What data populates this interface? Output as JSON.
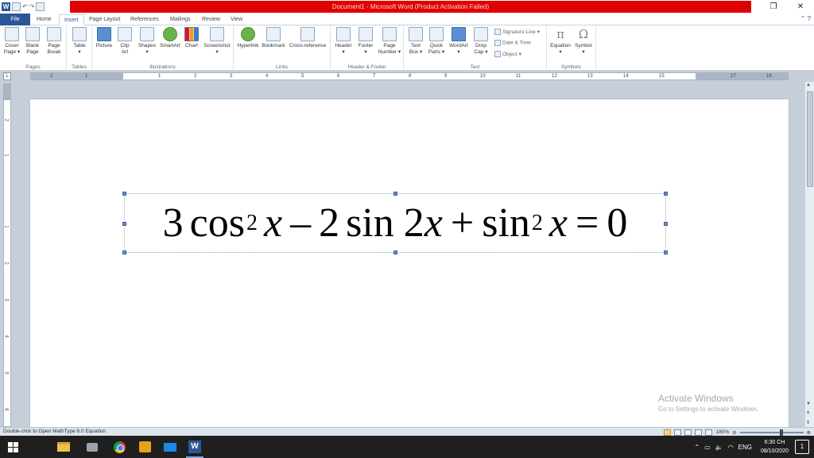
{
  "window": {
    "title": "Document1 - Microsoft Word (Product Activation Failed)",
    "controls": {
      "minimize": "–",
      "restore": "❐",
      "close": "✕"
    }
  },
  "tabs": [
    {
      "label": "File"
    },
    {
      "label": "Home"
    },
    {
      "label": "Insert"
    },
    {
      "label": "Page Layout"
    },
    {
      "label": "References"
    },
    {
      "label": "Mailings"
    },
    {
      "label": "Review"
    },
    {
      "label": "View"
    }
  ],
  "ribbon": {
    "pages": {
      "label": "Pages",
      "cover": "Cover\nPage ▾",
      "blank": "Blank\nPage",
      "break": "Page\nBreak"
    },
    "tables": {
      "label": "Tables",
      "table": "Table\n▾"
    },
    "illustrations": {
      "label": "Illustrations",
      "picture": "Picture",
      "clipart": "Clip\nArt",
      "shapes": "Shapes\n▾",
      "smartart": "SmartArt",
      "chart": "Chart",
      "screenshot": "Screenshot\n▾"
    },
    "links": {
      "label": "Links",
      "hyperlink": "Hyperlink",
      "bookmark": "Bookmark",
      "crossref": "Cross-reference"
    },
    "headerfooter": {
      "label": "Header & Footer",
      "header": "Header\n▾",
      "footer": "Footer\n▾",
      "pagenumber": "Page\nNumber ▾"
    },
    "text": {
      "label": "Text",
      "textbox": "Text\nBox ▾",
      "quickparts": "Quick\nParts ▾",
      "wordart": "WordArt\n▾",
      "dropcap": "Drop\nCap ▾",
      "signature": "Signature Line ▾",
      "datetime": "Date & Time",
      "object": "Object ▾"
    },
    "symbols": {
      "label": "Symbols",
      "equation": "Equation\n▾",
      "symbol": "Symbol\n▾"
    }
  },
  "ruler": {
    "corner": "L",
    "ticks": [
      "2",
      "1",
      "1",
      "2",
      "3",
      "4",
      "5",
      "6",
      "7",
      "8",
      "9",
      "10",
      "11",
      "12",
      "13",
      "14",
      "15",
      "17",
      "18"
    ],
    "vticks": [
      "2",
      "1",
      "1",
      "2",
      "3",
      "4",
      "5",
      "6"
    ]
  },
  "document": {
    "equation": {
      "coef1": "3",
      "fn1": "cos",
      "exp1": "2",
      "var1": "x",
      "op1": "–",
      "coef2": "2",
      "fn2": "sin",
      "arg2": "2",
      "var2": "x",
      "op2": "+",
      "fn3": "sin",
      "exp3": "2",
      "var3": "x",
      "eq": "=",
      "rhs": "0"
    }
  },
  "watermark": {
    "line1": "Activate Windows",
    "line2": "Go to Settings to activate Windows."
  },
  "statusbar": {
    "message": "Double-click to Open MathType 6.0 Equation",
    "zoom": "180%"
  },
  "taskbar": {
    "time": "6:30 CH",
    "date": "08/10/2020",
    "language": "ENG",
    "notifications": "1"
  }
}
